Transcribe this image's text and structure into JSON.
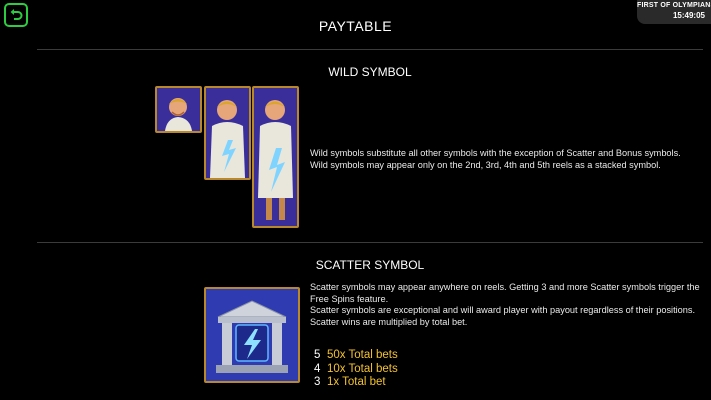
{
  "header": {
    "title": "PAYTABLE",
    "game_name": "FIRST OF OLYMPIANS",
    "time": "15:49:05"
  },
  "wild": {
    "title": "WILD SYMBOL",
    "line1": "Wild symbols substitute all other symbols with the exception of Scatter and Bonus symbols.",
    "line2": "Wild symbols may appear only on the 2nd, 3rd, 4th and 5th reels as a stacked symbol."
  },
  "scatter": {
    "title": "SCATTER SYMBOL",
    "line1": "Scatter symbols may appear anywhere on reels. Getting 3 and more Scatter symbols trigger the Free Spins feature.",
    "line2": "Scatter symbols are exceptional and will award player with payout regardless of their positions.",
    "line3": "Scatter wins are multiplied by total bet.",
    "pays": [
      {
        "count": "5",
        "value": "50x Total bets"
      },
      {
        "count": "4",
        "value": "10x Total bets"
      },
      {
        "count": "3",
        "value": "1x Total bet"
      }
    ]
  },
  "colors": {
    "accent_green": "#2ecc40",
    "gold": "#f2c230",
    "symbol_frame": "#b8882a",
    "scatter_background": "#2f3bb0"
  },
  "icons": [
    "back-arrow-icon",
    "zeus-icon",
    "temple-lightning-icon"
  ]
}
